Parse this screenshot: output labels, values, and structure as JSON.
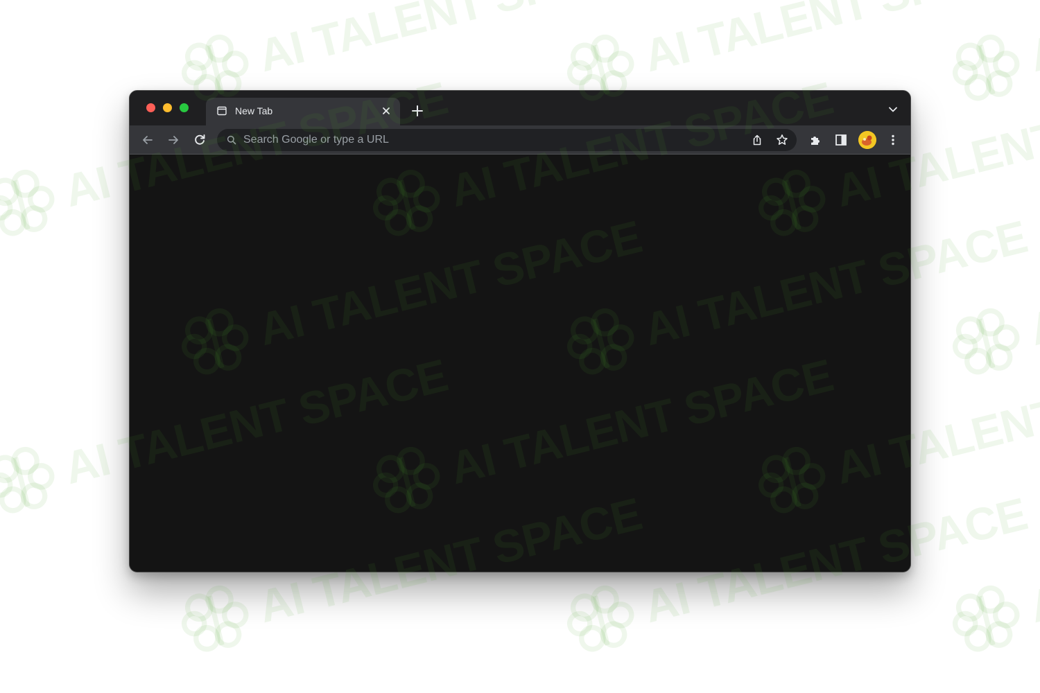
{
  "browser": {
    "tab": {
      "title": "New Tab",
      "icon": "new-tab-page-icon"
    },
    "toolbar": {
      "back_icon": "arrow-left-icon",
      "forward_icon": "arrow-right-icon",
      "reload_icon": "reload-icon",
      "omnibox_placeholder": "Search Google or type a URL",
      "omnibox_value": "",
      "extensions_icon": "puzzle-icon",
      "side_panel_icon": "side-panel-icon",
      "menu_icon": "kebab-menu-icon"
    }
  },
  "watermark": {
    "text": "AI TALENT SPACE",
    "icon": "brain-icon"
  },
  "colors": {
    "frame": "#1f1f21",
    "active_tab": "#35363a",
    "toolbar": "#35363a",
    "omnibox": "#202124",
    "content": "#141414",
    "traffic_red": "#fe5f57",
    "traffic_yellow": "#febc2e",
    "traffic_green": "#28c840",
    "watermark": "#50aa28"
  }
}
